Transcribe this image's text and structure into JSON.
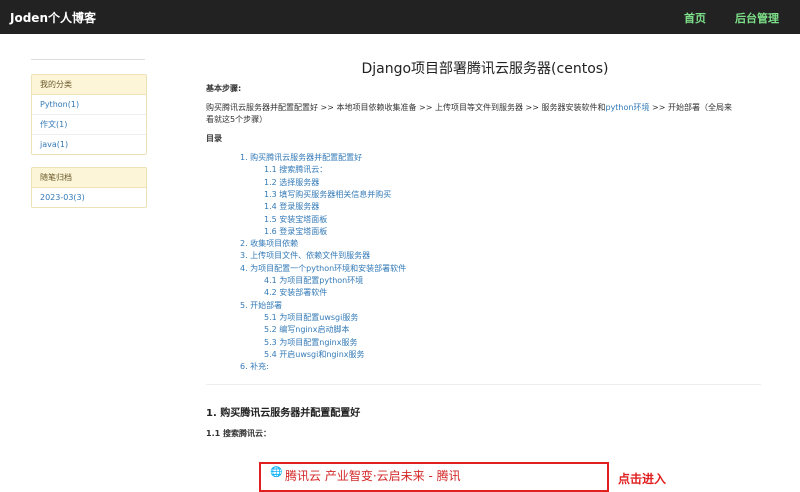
{
  "navbar": {
    "brand": "Joden个人博客",
    "links": [
      "首页",
      "后台管理"
    ]
  },
  "sidebar": {
    "categories": {
      "title": "我的分类",
      "items": [
        "Python(1)",
        "作文(1)",
        "java(1)"
      ]
    },
    "archive": {
      "title": "随笔归档",
      "items": [
        "2023-03(3)"
      ]
    }
  },
  "article": {
    "title": "Django项目部署腾讯云服务器(centos)",
    "steps_heading": "基本步骤:",
    "steps_text_1": "购买腾讯云服务器并配置配置好 >> 本地项目依赖收集准备 >> 上传项目等文件到服务器 >> 服务器安装软件和",
    "steps_link": "python环境",
    "steps_text_2": " >> 开始部署（全局来",
    "steps_text_3": "看就这5个步骤）",
    "toc_heading": "目录",
    "toc": [
      {
        "level": 1,
        "text": "1. 购买腾讯云服务器并配置配置好"
      },
      {
        "level": 2,
        "text": "1.1 搜索腾讯云："
      },
      {
        "level": 2,
        "text": "1.2 选择服务器"
      },
      {
        "level": 2,
        "text": "1.3 填写购买服务器相关信息并购买"
      },
      {
        "level": 2,
        "text": "1.4 登录服务器"
      },
      {
        "level": 2,
        "text": "1.5 安装宝塔面板"
      },
      {
        "level": 2,
        "text": "1.6 登录宝塔面板"
      },
      {
        "level": 1,
        "text": "2. 收集项目依赖"
      },
      {
        "level": 1,
        "text": "3. 上传项目文件、依赖文件到服务器"
      },
      {
        "level": 1,
        "text": "4. 为项目配置一个python环境和安装部署软件"
      },
      {
        "level": 2,
        "text": "4.1 为项目配置python环境"
      },
      {
        "level": 2,
        "text": "4.2 安装部署软件"
      },
      {
        "level": 1,
        "text": "5. 开始部署"
      },
      {
        "level": 2,
        "text": "5.1 为项目配置uwsgi服务"
      },
      {
        "level": 2,
        "text": "5.2 编写nginx启动脚本"
      },
      {
        "level": 2,
        "text": "5.3 为项目配置nginx服务"
      },
      {
        "level": 2,
        "text": "5.4 开启uwsgi和nginx服务"
      },
      {
        "level": 1,
        "text": "6. 补充:"
      }
    ],
    "section1_heading": "1. 购买腾讯云服务器并配置配置好",
    "section1_1_heading": "1.1 搜索腾讯云：",
    "screenshot_text": "腾讯云 产业智变·云启未来 - 腾讯",
    "screenshot_side": "点击进入"
  }
}
